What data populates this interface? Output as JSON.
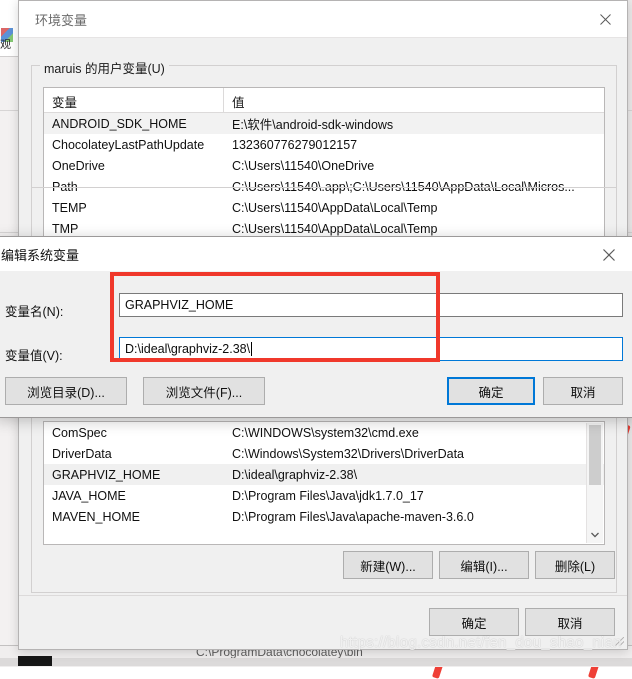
{
  "env_window": {
    "title": "环境变量",
    "close_icon": "close-icon",
    "user_group": {
      "legend": "maruis 的用户变量(U)",
      "columns": [
        "变量",
        "值"
      ],
      "rows": [
        {
          "name": "ANDROID_SDK_HOME",
          "value": "E:\\软件\\android-sdk-windows"
        },
        {
          "name": "ChocolateyLastPathUpdate",
          "value": "132360776279012157"
        },
        {
          "name": "OneDrive",
          "value": "C:\\Users\\11540\\OneDrive"
        },
        {
          "name": "Path",
          "value": "C:\\Users\\11540\\.app\\;C:\\Users\\11540\\AppData\\Local\\Micros..."
        },
        {
          "name": "TEMP",
          "value": "C:\\Users\\11540\\AppData\\Local\\Temp"
        },
        {
          "name": "TMP",
          "value": "C:\\Users\\11540\\AppData\\Local\\Temp"
        }
      ]
    },
    "system_group": {
      "rows": [
        {
          "name": "ComSpec",
          "value": "C:\\WINDOWS\\system32\\cmd.exe"
        },
        {
          "name": "DriverData",
          "value": "C:\\Windows\\System32\\Drivers\\DriverData"
        },
        {
          "name": "GRAPHVIZ_HOME",
          "value": "D:\\ideal\\graphviz-2.38\\"
        },
        {
          "name": "JAVA_HOME",
          "value": "D:\\Program Files\\Java\\jdk1.7.0_17"
        },
        {
          "name": "MAVEN_HOME",
          "value": "D:\\Program Files\\Java\\apache-maven-3.6.0"
        }
      ],
      "selected_row_index": 2,
      "scroll_down_icon": "chevron-down-icon"
    },
    "system_buttons": {
      "new": "新建(W)...",
      "edit": "编辑(I)...",
      "delete": "删除(L)"
    },
    "footer_buttons": {
      "ok": "确定",
      "cancel": "取消"
    }
  },
  "edit_dialog": {
    "title": "编辑系统变量",
    "close_icon": "close-icon",
    "name_label": "变量名(N):",
    "name_value": "GRAPHVIZ_HOME",
    "value_label": "变量值(V):",
    "value_value": "D:\\ideal\\graphviz-2.38\\",
    "browse_dir": "浏览目录(D)...",
    "browse_file": "浏览文件(F)...",
    "ok": "确定",
    "cancel": "取消"
  },
  "background": {
    "left_label": "观",
    "bottom_window_text": "C:\\ProgramData\\chocolatey\\bin"
  },
  "annotation": {
    "highlight_color": "#f0382b",
    "accent_color": "#0078d7"
  },
  "watermark": {
    "text": "https://blog.csdn.net/fen_dou_shao_nian"
  }
}
